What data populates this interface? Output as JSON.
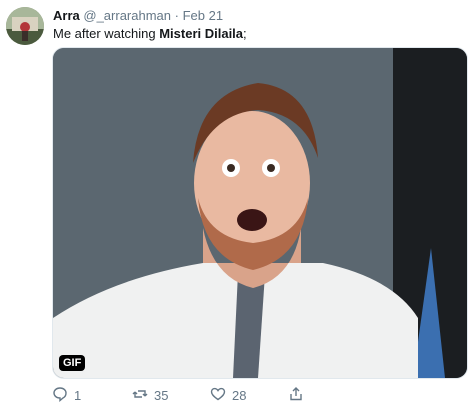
{
  "tweet": {
    "display_name": "Arra",
    "handle": "@_arrarahman",
    "separator": "·",
    "date": "Feb 21",
    "text_prefix": "Me after watching ",
    "text_bold": "Misteri Dilaila",
    "text_suffix": ";",
    "media": {
      "badge": "GIF"
    },
    "actions": {
      "reply_count": "1",
      "retweet_count": "35",
      "like_count": "28"
    }
  },
  "icons": [
    "reply-icon",
    "retweet-icon",
    "like-icon",
    "share-icon"
  ],
  "colors": {
    "muted": "#657786",
    "text": "#14171a"
  }
}
